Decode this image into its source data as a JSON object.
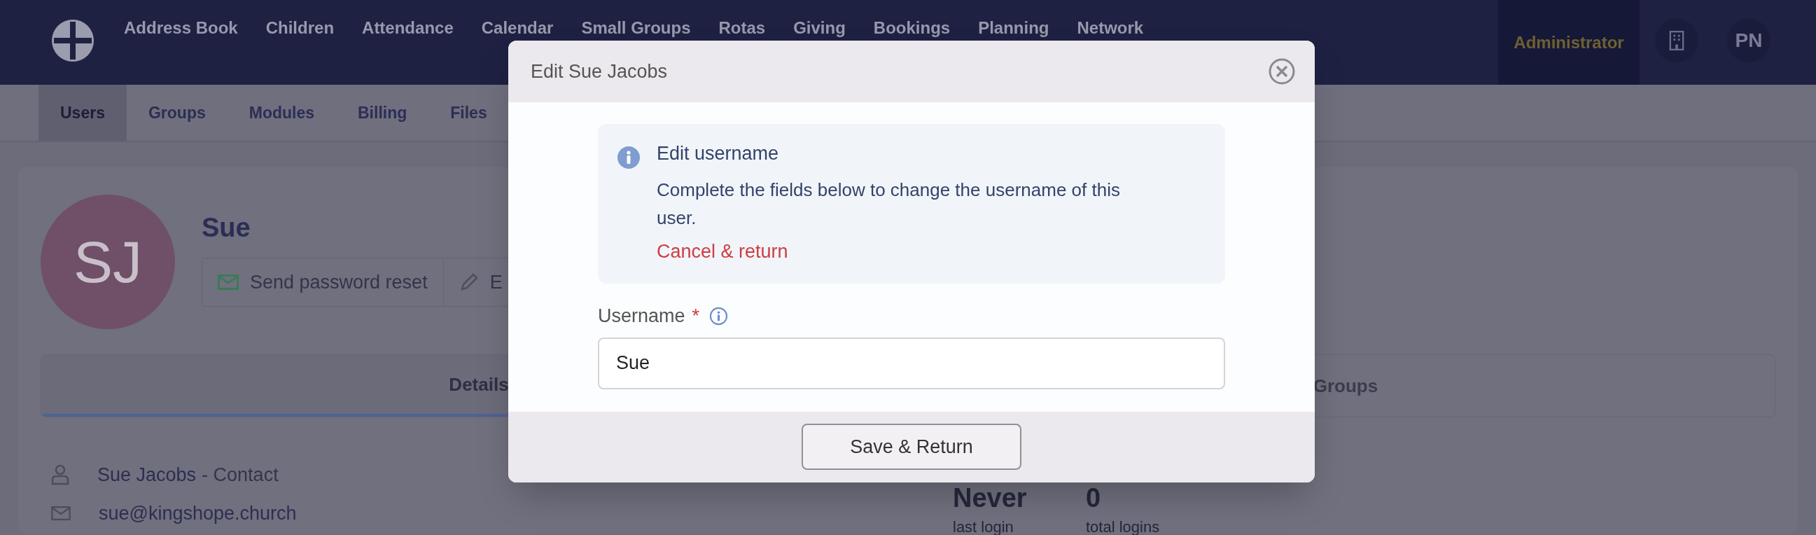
{
  "top_nav": {
    "items": [
      "Address Book",
      "Children",
      "Attendance",
      "Calendar",
      "Small Groups",
      "Rotas",
      "Giving",
      "Bookings",
      "Planning",
      "Network"
    ],
    "role": "Administrator",
    "user_initials": "PN"
  },
  "sub_nav": {
    "items": [
      {
        "label": "Users",
        "selected": true
      },
      {
        "label": "Groups",
        "selected": false
      },
      {
        "label": "Modules",
        "selected": false
      },
      {
        "label": "Billing",
        "selected": false
      },
      {
        "label": "Files",
        "selected": false
      }
    ]
  },
  "profile": {
    "initials": "SJ",
    "name": "Sue",
    "actions": [
      {
        "kind": "email",
        "label": "Send password reset"
      },
      {
        "kind": "edit",
        "label": "E"
      }
    ],
    "tabs": [
      {
        "label": "Details",
        "selected": true
      },
      {
        "label": "Groups",
        "selected": false
      }
    ],
    "contact": {
      "name": "Sue Jacobs",
      "role": "- Contact",
      "email": "sue@kingshope.church"
    },
    "stats": [
      {
        "value": "Never",
        "label": "last login"
      },
      {
        "value": "0",
        "label": "total logins"
      }
    ]
  },
  "modal": {
    "title": "Edit Sue Jacobs",
    "info": {
      "title": "Edit username",
      "text": "Complete the fields below to change the username of this user.",
      "link": "Cancel & return"
    },
    "field": {
      "label": "Username",
      "required_mark": "*",
      "value": "Sue"
    },
    "buttons": [
      "Save & Return"
    ]
  }
}
